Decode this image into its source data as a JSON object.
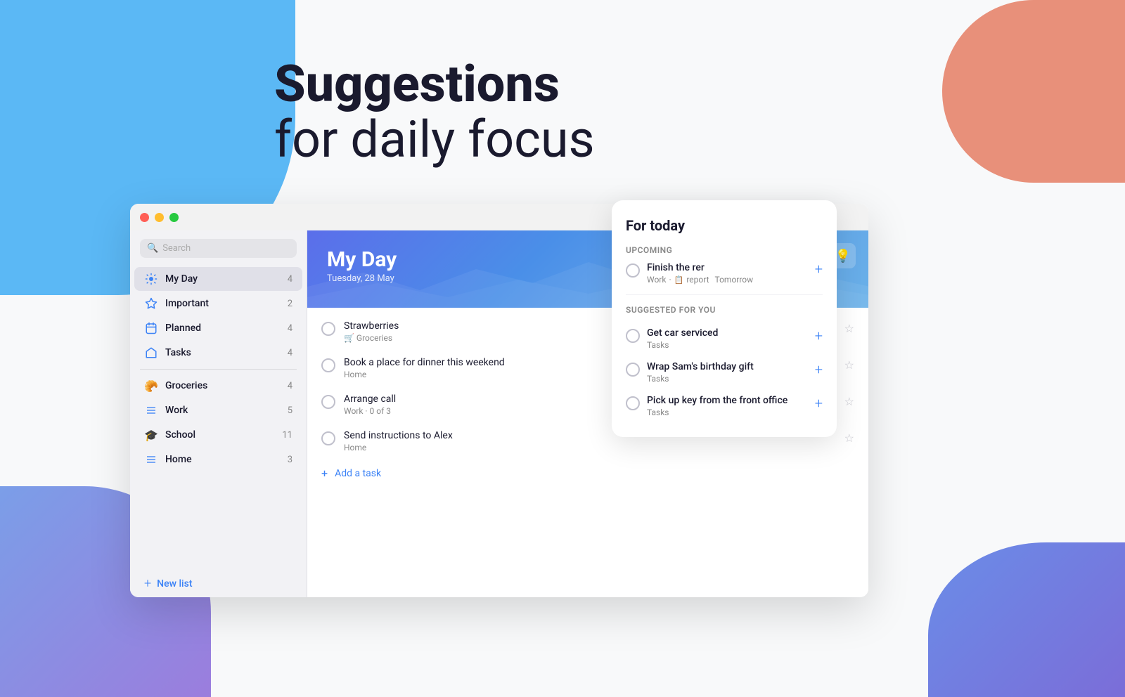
{
  "background": {
    "blue_color": "#5bb8f5",
    "coral_color": "#e8907a",
    "purple_color": "#7b6dd8"
  },
  "hero": {
    "line1": "Suggestions",
    "line2": "for daily focus"
  },
  "window": {
    "titlebar": {
      "red": "#ff5f56",
      "yellow": "#ffbd2e",
      "green": "#27c93f"
    }
  },
  "sidebar": {
    "search_placeholder": "Search",
    "nav_items": [
      {
        "id": "my-day",
        "label": "My Day",
        "icon": "☀️",
        "count": "4",
        "active": true
      },
      {
        "id": "important",
        "label": "Important",
        "icon": "⭐",
        "count": "2",
        "active": false
      },
      {
        "id": "planned",
        "label": "Planned",
        "icon": "📅",
        "count": "4",
        "active": false
      },
      {
        "id": "tasks",
        "label": "Tasks",
        "icon": "🏠",
        "count": "4",
        "active": false
      }
    ],
    "list_items": [
      {
        "id": "groceries",
        "label": "Groceries",
        "icon": "🥐",
        "count": "4"
      },
      {
        "id": "work",
        "label": "Work",
        "icon": "☰",
        "count": "5"
      },
      {
        "id": "school",
        "label": "School",
        "icon": "🎓",
        "count": "11"
      },
      {
        "id": "home",
        "label": "Home",
        "icon": "☰",
        "count": "3"
      }
    ],
    "new_list_label": "New list"
  },
  "main": {
    "header": {
      "title": "My Day",
      "date": "Tuesday, 28 May",
      "sun_icon": "💡"
    },
    "tasks": [
      {
        "id": "task1",
        "title": "Strawberries",
        "subtitle": "🛒 Groceries",
        "starred": false
      },
      {
        "id": "task2",
        "title": "Book a place for dinner this weekend",
        "subtitle": "Home",
        "starred": false
      },
      {
        "id": "task3",
        "title": "Arrange call",
        "subtitle": "Work · 0 of 3",
        "starred": false
      },
      {
        "id": "task4",
        "title": "Send instructions to Alex",
        "subtitle": "Home",
        "starred": false
      }
    ],
    "add_task_label": "Add a task"
  },
  "for_today": {
    "title": "For today",
    "upcoming_label": "Upcoming",
    "upcoming_item": {
      "title": "Finish the rer",
      "meta_list": "Work",
      "meta_type": "report",
      "meta_date": "Tomorrow"
    },
    "suggested_label": "Suggested for you",
    "suggested_items": [
      {
        "title": "Get car serviced",
        "list": "Tasks"
      },
      {
        "title": "Wrap Sam's birthday gift",
        "list": "Tasks"
      },
      {
        "title": "Pick up key from the front office",
        "list": "Tasks"
      }
    ]
  }
}
